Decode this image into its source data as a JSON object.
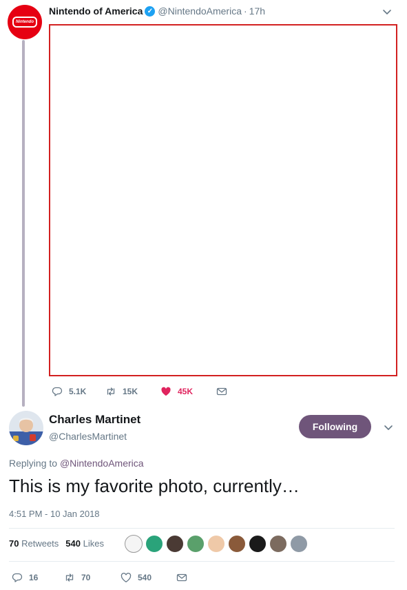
{
  "top_tweet": {
    "display_name": "Nintendo of America",
    "handle": "@NintendoAmerica",
    "separator": "·",
    "time_ago": "17h",
    "avatar_logo_text": "Nintendo",
    "reply_count": "5.1K",
    "retweet_count": "15K",
    "like_count": "45K"
  },
  "reply_tweet": {
    "display_name": "Charles Martinet",
    "handle": "@CharlesMartinet",
    "follow_button": "Following",
    "replying_prefix": "Replying to",
    "replying_to": "@NintendoAmerica",
    "text": "This is my favorite photo, currently…",
    "timestamp": "4:51 PM - 10 Jan 2018",
    "retweets_value": "70",
    "retweets_label": "Retweets",
    "likes_value": "540",
    "likes_label": "Likes",
    "reply_count": "16",
    "retweet_count": "70",
    "like_count": "540"
  },
  "colors": {
    "brand_purple": "#6f557a",
    "nintendo_red": "#e60012",
    "like_pink": "#e0245e",
    "verified_blue": "#1da1f2",
    "muted": "#657786"
  },
  "icons": [
    "chevron-down-icon",
    "verified-icon",
    "reply-icon",
    "retweet-icon",
    "heart-icon",
    "message-icon"
  ]
}
